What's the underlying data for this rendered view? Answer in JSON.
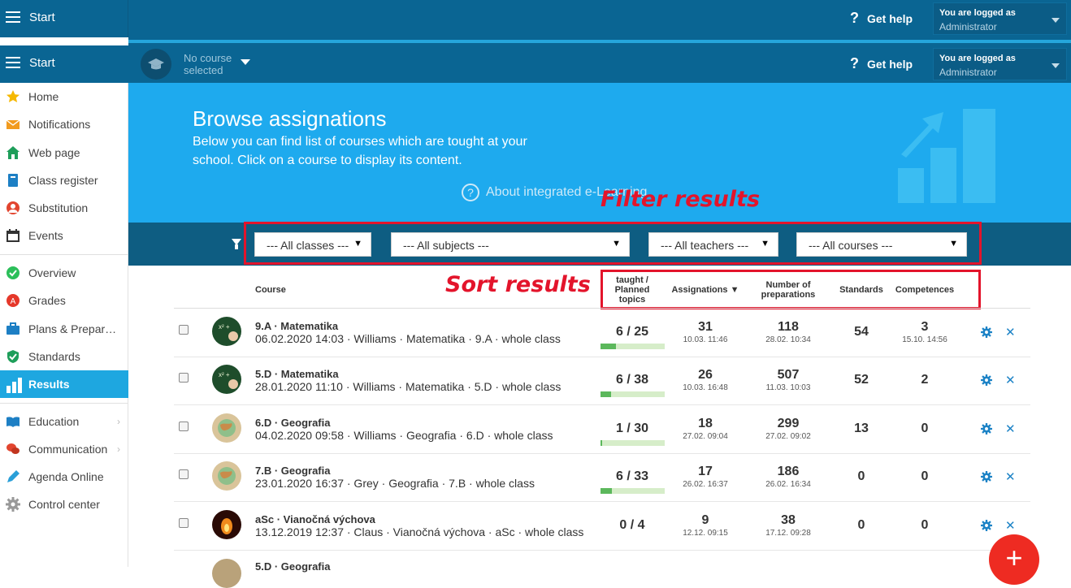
{
  "topbar": {
    "start_label": "Start",
    "help_label": "Get help",
    "user_line1": "You are logged as",
    "user_line2": "Administrator",
    "course_selector": "No course selected"
  },
  "sidebar": {
    "items": [
      {
        "label": "Home",
        "icon": "star-icon"
      },
      {
        "label": "Notifications",
        "icon": "envelope-icon"
      },
      {
        "label": "Web page",
        "icon": "house-icon"
      },
      {
        "label": "Class register",
        "icon": "book-icon"
      },
      {
        "label": "Substitution",
        "icon": "person-icon"
      },
      {
        "label": "Events",
        "icon": "calendar-icon"
      },
      {
        "label": "Overview",
        "icon": "check-circle-icon"
      },
      {
        "label": "Grades",
        "icon": "grade-icon"
      },
      {
        "label": "Plans & Prepar…",
        "icon": "briefcase-icon"
      },
      {
        "label": "Standards",
        "icon": "shield-check-icon"
      },
      {
        "label": "Results",
        "icon": "bar-chart-icon"
      },
      {
        "label": "Education",
        "icon": "open-book-icon"
      },
      {
        "label": "Communication",
        "icon": "chat-icon"
      },
      {
        "label": "Agenda Online",
        "icon": "pen-icon"
      },
      {
        "label": "Control center",
        "icon": "gear-icon"
      }
    ]
  },
  "hero": {
    "title": "Browse assignations",
    "description": "Below you can find list of courses which are tought at your school. Click on a course to display its content.",
    "about_link": "About integrated e-Learning"
  },
  "annotations": {
    "filter": "Filter results",
    "sort": "Sort results"
  },
  "filters": {
    "classes": "--- All classes ---",
    "subjects": "--- All subjects ---",
    "teachers": "--- All teachers ---",
    "courses": "--- All courses ---"
  },
  "table": {
    "headers": {
      "course": "Course",
      "topics": "taught / Planned topics",
      "assignments": "Assignations ▼",
      "preparations": "Number of preparations",
      "standards": "Standards",
      "competences": "Competences"
    },
    "rows": [
      {
        "name": "9.A · Matematika",
        "meta": "06.02.2020 14:03 · Williams · Matematika · 9.A · whole class",
        "topics": "6 / 25",
        "progress": 0.24,
        "assign": "31",
        "assign_date": "10.03. 11:46",
        "prep": "118",
        "prep_date": "28.02. 10:34",
        "standards": "54",
        "comp": "3",
        "comp_date": "15.10. 14:56",
        "avatar": "math"
      },
      {
        "name": "5.D · Matematika",
        "meta": "28.01.2020 11:10 · Williams · Matematika · 5.D · whole class",
        "topics": "6 / 38",
        "progress": 0.16,
        "assign": "26",
        "assign_date": "10.03. 16:48",
        "prep": "507",
        "prep_date": "11.03. 10:03",
        "standards": "52",
        "comp": "2",
        "comp_date": "",
        "avatar": "math"
      },
      {
        "name": "6.D · Geografia",
        "meta": "04.02.2020 09:58 · Williams · Geografia · 6.D · whole class",
        "topics": "1 / 30",
        "progress": 0.03,
        "assign": "18",
        "assign_date": "27.02. 09:04",
        "prep": "299",
        "prep_date": "27.02. 09:02",
        "standards": "13",
        "comp": "0",
        "comp_date": "",
        "avatar": "geo"
      },
      {
        "name": "7.B · Geografia",
        "meta": "23.01.2020 16:37 · Grey · Geografia · 7.B · whole class",
        "topics": "6 / 33",
        "progress": 0.18,
        "assign": "17",
        "assign_date": "26.02. 16:37",
        "prep": "186",
        "prep_date": "26.02. 16:34",
        "standards": "0",
        "comp": "0",
        "comp_date": "",
        "avatar": "geo"
      },
      {
        "name": "aSc · Vianočná výchova",
        "meta": "13.12.2019 12:37 · Claus · Vianočná výchova · aSc · whole class",
        "topics": "0 / 4",
        "progress": 0,
        "assign": "9",
        "assign_date": "12.12. 09:15",
        "prep": "38",
        "prep_date": "17.12. 09:28",
        "standards": "0",
        "comp": "0",
        "comp_date": "",
        "avatar": "xmas"
      }
    ]
  },
  "partial_row": {
    "name": "5.D · Geografia"
  },
  "fab_label": "+"
}
